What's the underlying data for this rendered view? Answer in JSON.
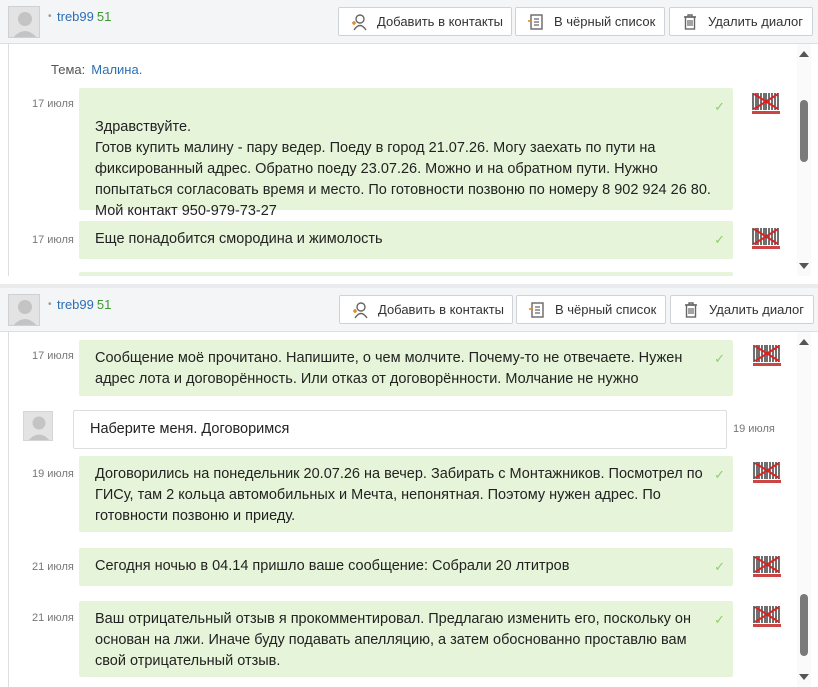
{
  "header": {
    "username": "treb99",
    "rating": "51",
    "add_contact": "Добавить в контакты",
    "blacklist": "В чёрный список",
    "delete_dialog": "Удалить диалог"
  },
  "topic": {
    "label": "Тема:",
    "value": "Малина."
  },
  "panel1_messages": [
    {
      "date": "17 июля",
      "text": "Здравствуйте.\nГотов купить малину - пару ведер. Поеду в город 21.07.26. Могу заехать по пути на фиксированный адрес. Обратно поеду 23.07.26. Можно и на обратном пути. Нужно попытаться согласовать время и место. По готовности позвоню по номеру 8 902 924 26 80. Мой контакт 950-979-73-27"
    },
    {
      "date": "17 июля",
      "text": "Еще понадобится смородина и жимолость"
    }
  ],
  "panel2_messages": [
    {
      "date": "17 июля",
      "text": "Сообщение моё прочитано. Напишите, о чем молчите. Почему-то не отвечаете. Нужен адрес лота и договорённость. Или отказ от договорённости. Молчание не нужно"
    },
    {
      "date": "19 июля",
      "text": "Наберите меня. Договоримся"
    },
    {
      "date": "19 июля",
      "text": "Договорились на понедельник 20.07.26 на вечер. Забирать с Монтажников. Посмотрел по ГИСу, там 2 кольца автомобильных и Мечта, непонятная. Поэтому нужен адрес. По готовности позвоню и приеду."
    },
    {
      "date": "21 июля",
      "text": "Сегодня ночью в 04.14 пришло ваше сообщение: Собрали 20 лтитров"
    },
    {
      "date": "21 июля",
      "text": "Ваш отрицательный отзыв я прокомментировал. Предлагаю изменить его, поскольку он основан на лжи. Иначе буду подавать апелляцию, а затем обоснованно проставлю вам свой отрицательный отзыв."
    }
  ],
  "icons": {
    "check": "✓",
    "dot": "•"
  }
}
